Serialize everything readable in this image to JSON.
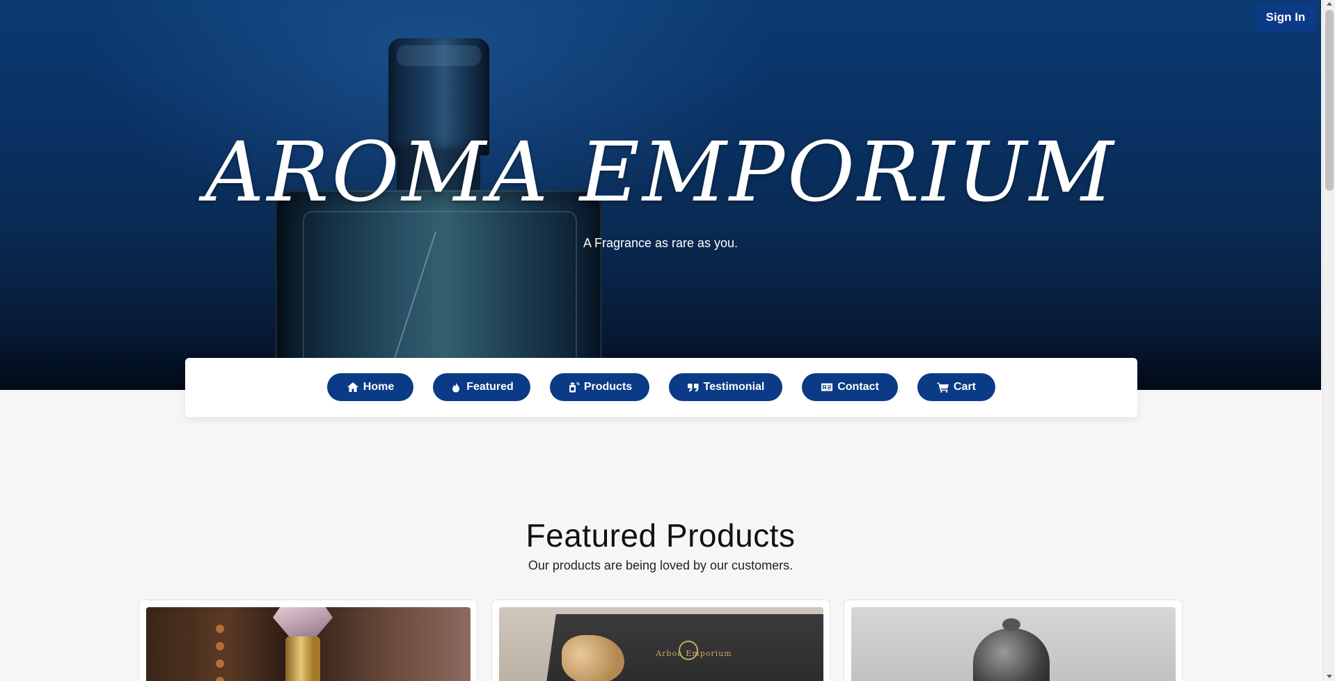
{
  "hero": {
    "title": "AROMA EMPORIUM",
    "tagline": "A Fragrance as rare as you."
  },
  "auth": {
    "signin_label": "Sign In"
  },
  "nav": {
    "items": [
      {
        "label": "Home",
        "icon": "home-icon"
      },
      {
        "label": "Featured",
        "icon": "fire-icon"
      },
      {
        "label": "Products",
        "icon": "spray-bottle-icon"
      },
      {
        "label": "Testimonial",
        "icon": "quote-icon"
      },
      {
        "label": "Contact",
        "icon": "contact-card-icon"
      },
      {
        "label": "Cart",
        "icon": "cart-icon"
      }
    ]
  },
  "featured": {
    "title": "Featured Products",
    "subtitle": "Our products are being loved by our customers.",
    "products": [
      {
        "image": "perfume-bottle-crystal-cap"
      },
      {
        "image": "gift-box-with-ribbon",
        "box_text": "Arboa Emporium"
      },
      {
        "image": "ornate-metal-bottle"
      }
    ]
  },
  "colors": {
    "primary": "#0b3a86",
    "hero_top": "#0b3b72",
    "hero_bottom": "#020a16",
    "page_bg": "#f6f6f6"
  }
}
